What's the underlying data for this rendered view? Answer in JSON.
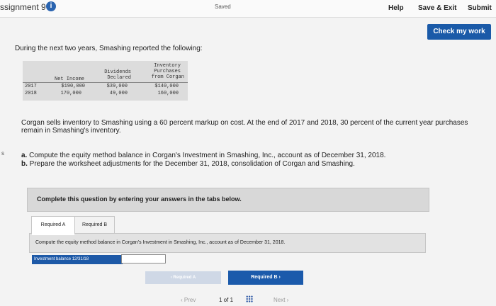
{
  "header": {
    "assignment_title": "ssignment 9",
    "info_icon": "i",
    "saved": "Saved",
    "help": "Help",
    "save_exit": "Save & Exit",
    "submit": "Submit"
  },
  "check_button": "Check my work",
  "intro": "During the next two years, Smashing reported the following:",
  "table": {
    "headers": [
      [
        "",
        ""
      ],
      [
        "Net Income"
      ],
      [
        "Dividends",
        "Declared"
      ],
      [
        "Inventory",
        "Purchases",
        "from Corgan"
      ]
    ],
    "rows": [
      {
        "year": "2017",
        "net_income": "$190,000",
        "dividends": "$39,000",
        "purchases": "$140,000"
      },
      {
        "year": "2018",
        "net_income": "170,000",
        "dividends": "49,000",
        "purchases": "160,000"
      }
    ]
  },
  "body": "Corgan sells inventory to Smashing using a 60 percent markup on cost. At the end of 2017 and 2018, 30 percent of the current year purchases remain in Smashing's inventory.",
  "margin_mark": "s",
  "questions": {
    "a_label": "a.",
    "a_text": "Compute the equity method balance in Corgan's Investment in Smashing, Inc., account as of December 31, 2018.",
    "b_label": "b.",
    "b_text": "Prepare the worksheet adjustments for the December 31, 2018, consolidation of Corgan and Smashing."
  },
  "banner": "Complete this question by entering your answers in the tabs below.",
  "tabs": {
    "a": "Required A",
    "b": "Required B"
  },
  "tab_panel_text": "Compute the equity method balance in Corgan's Investment in Smashing, Inc., account as of December 31, 2018.",
  "input": {
    "label": "Investment balance 12/31/18",
    "value": ""
  },
  "nav": {
    "prev": "‹ Required A",
    "next": "Required B ›"
  },
  "pager": {
    "prev": "‹ Prev",
    "page": "1 of 1",
    "next": "Next ›"
  },
  "colors": {
    "accent": "#1b5aab",
    "page_bg": "#f3f3f3",
    "banner_bg": "#d8d8d8"
  }
}
